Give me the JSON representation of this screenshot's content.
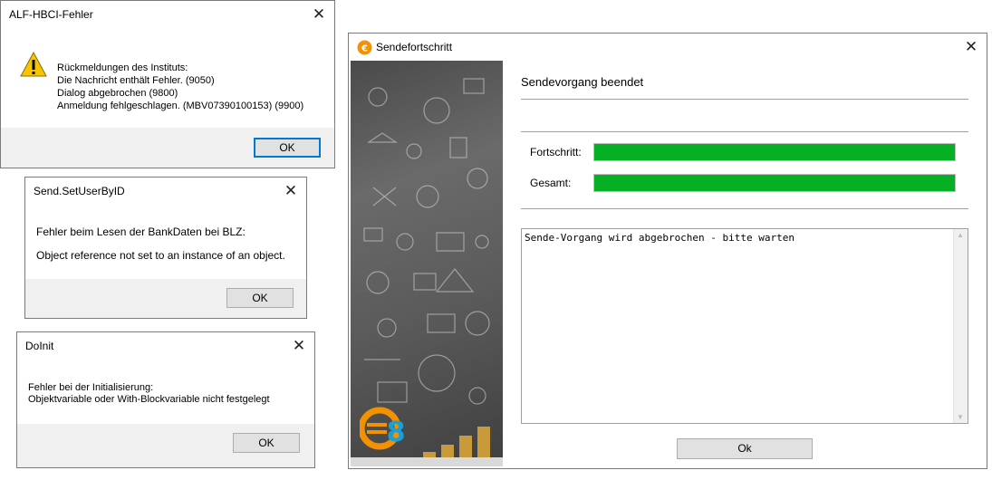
{
  "dialog1": {
    "title": "ALF-HBCI-Fehler",
    "lines": [
      "Rückmeldungen des Instituts:",
      "Die Nachricht enthält Fehler. (9050)",
      "Dialog abgebrochen (9800)",
      "Anmeldung fehlgeschlagen. (MBV07390100153) (9900)"
    ],
    "ok_label": "OK",
    "close_glyph": "✕"
  },
  "dialog2": {
    "title": "Send.SetUserByID",
    "line1": "Fehler beim Lesen der BankDaten bei BLZ:",
    "line2": "Object reference not set to an instance of an object.",
    "ok_label": "OK",
    "close_glyph": "✕"
  },
  "dialog3": {
    "title": "DoInit",
    "line1": "Fehler bei der Initialisierung:",
    "line2": "Objektvariable oder With-Blockvariable nicht festgelegt",
    "ok_label": "OK",
    "close_glyph": "✕"
  },
  "main": {
    "title": "Sendefortschritt",
    "logo_text": "€8",
    "status_heading": "Sendevorgang beendet",
    "progress_label": "Fortschritt:",
    "progress_value": 1.0,
    "total_label": "Gesamt:",
    "total_value": 1.0,
    "log_text": "Sende-Vorgang wird abgebrochen - bitte warten",
    "ok_label": "Ok",
    "close_glyph": "✕",
    "progress_color": "#06b025"
  },
  "icons": [
    "warning-icon",
    "close-icon",
    "app-logo-icon",
    "euro-8-logo"
  ]
}
